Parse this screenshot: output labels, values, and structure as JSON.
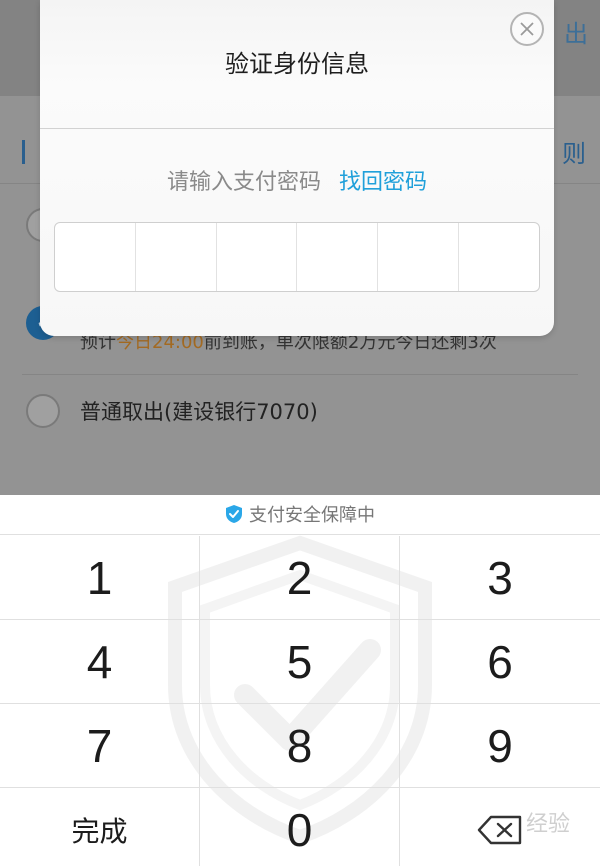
{
  "background_page": {
    "header_action": "出",
    "tab_right": "则",
    "info_prefix": "预计",
    "info_highlight": "今日24:00",
    "info_suffix": "前到账，单次限额2万元今日还剩3次",
    "option_normal_label": "普通取出(建设银行7070)"
  },
  "modal": {
    "title": "验证身份信息",
    "prompt": "请输入支付密码",
    "forgot_link": "找回密码",
    "pin_length": 6
  },
  "keyboard": {
    "security_note": "支付安全保障中",
    "keys": [
      "1",
      "2",
      "3",
      "4",
      "5",
      "6",
      "7",
      "8",
      "9"
    ],
    "done_label": "完成",
    "zero_label": "0"
  },
  "watermark_text": "经验",
  "colors": {
    "accent_link": "#20a0da",
    "shield_blue": "#2aa7e8",
    "highlight_orange": "#a36a22"
  }
}
